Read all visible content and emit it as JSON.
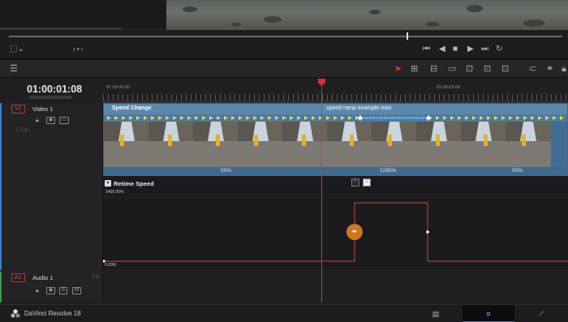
{
  "timeline": {
    "timecode": "01:00:01:08",
    "ruler_timecodes": [
      "01:00:00:00",
      "01:00:02:00"
    ]
  },
  "tracks": {
    "video": {
      "badge": "V1",
      "name": "Video 1",
      "clip_count": "1 Clip"
    },
    "audio": {
      "badge": "A1",
      "name": "Audio 1",
      "channel": "2.0",
      "solo": "S",
      "mute": "M"
    }
  },
  "clip": {
    "left_label": "Speed Change",
    "right_label": "speed ramp example.mov",
    "speeds": [
      "50%",
      "1265%",
      "50%"
    ]
  },
  "retime": {
    "title": "Retime Speed",
    "max_value": "1400.00%",
    "min_value": "0.00%"
  },
  "bottom_bar": {
    "app_name": "DaVinci Resolve 18"
  },
  "colors": {
    "accent_red": "#d63434",
    "clip_blue": "#3f6d93",
    "clip_header": "#5e87ac",
    "keyframe_orange": "#e0801e"
  },
  "icons": {
    "transport": [
      "skip-to-start-icon",
      "step-back-icon",
      "stop-icon",
      "play-icon",
      "step-forward-icon",
      "skip-to-end-icon",
      "loop-icon"
    ],
    "toolbar": [
      "selection-arrow-icon",
      "trim-icon",
      "dynamic-trim-icon",
      "blade-icon",
      "snapping-icon",
      "linked-selection-icon",
      "lock-icon"
    ]
  }
}
